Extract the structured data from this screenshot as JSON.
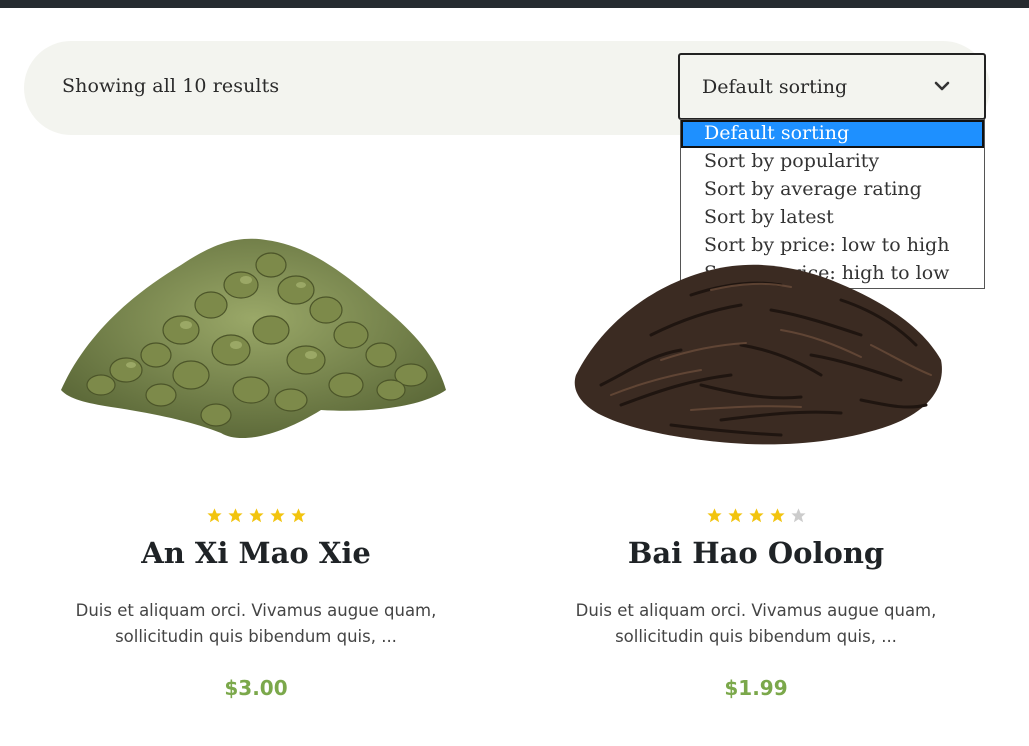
{
  "toolbar": {
    "result_count": "Showing all 10 results",
    "sort": {
      "selected": "Default sorting",
      "options": [
        "Default sorting",
        "Sort by popularity",
        "Sort by average rating",
        "Sort by latest",
        "Sort by price: low to high",
        "Sort by price: high to low"
      ]
    }
  },
  "products": [
    {
      "name": "An Xi Mao Xie",
      "rating": 5,
      "rating_max": 5,
      "description": "Duis et aliquam orci. Vivamus augue quam, sollicitudin quis bibendum quis, ...",
      "price": "$3.00",
      "image_icon": "green-oolong-tea-pile"
    },
    {
      "name": "Bai Hao Oolong",
      "rating": 4,
      "rating_max": 5,
      "description": "Duis et aliquam orci. Vivamus augue quam, sollicitudin quis bibendum quis, ...",
      "price": "$1.99",
      "image_icon": "dark-oolong-tea-pile"
    }
  ],
  "colors": {
    "star_filled": "#f2c40f",
    "star_empty": "#cccccc",
    "price": "#7ba84b",
    "selected_option": "#1e90ff",
    "toolbar_bg": "#f3f4ef"
  }
}
